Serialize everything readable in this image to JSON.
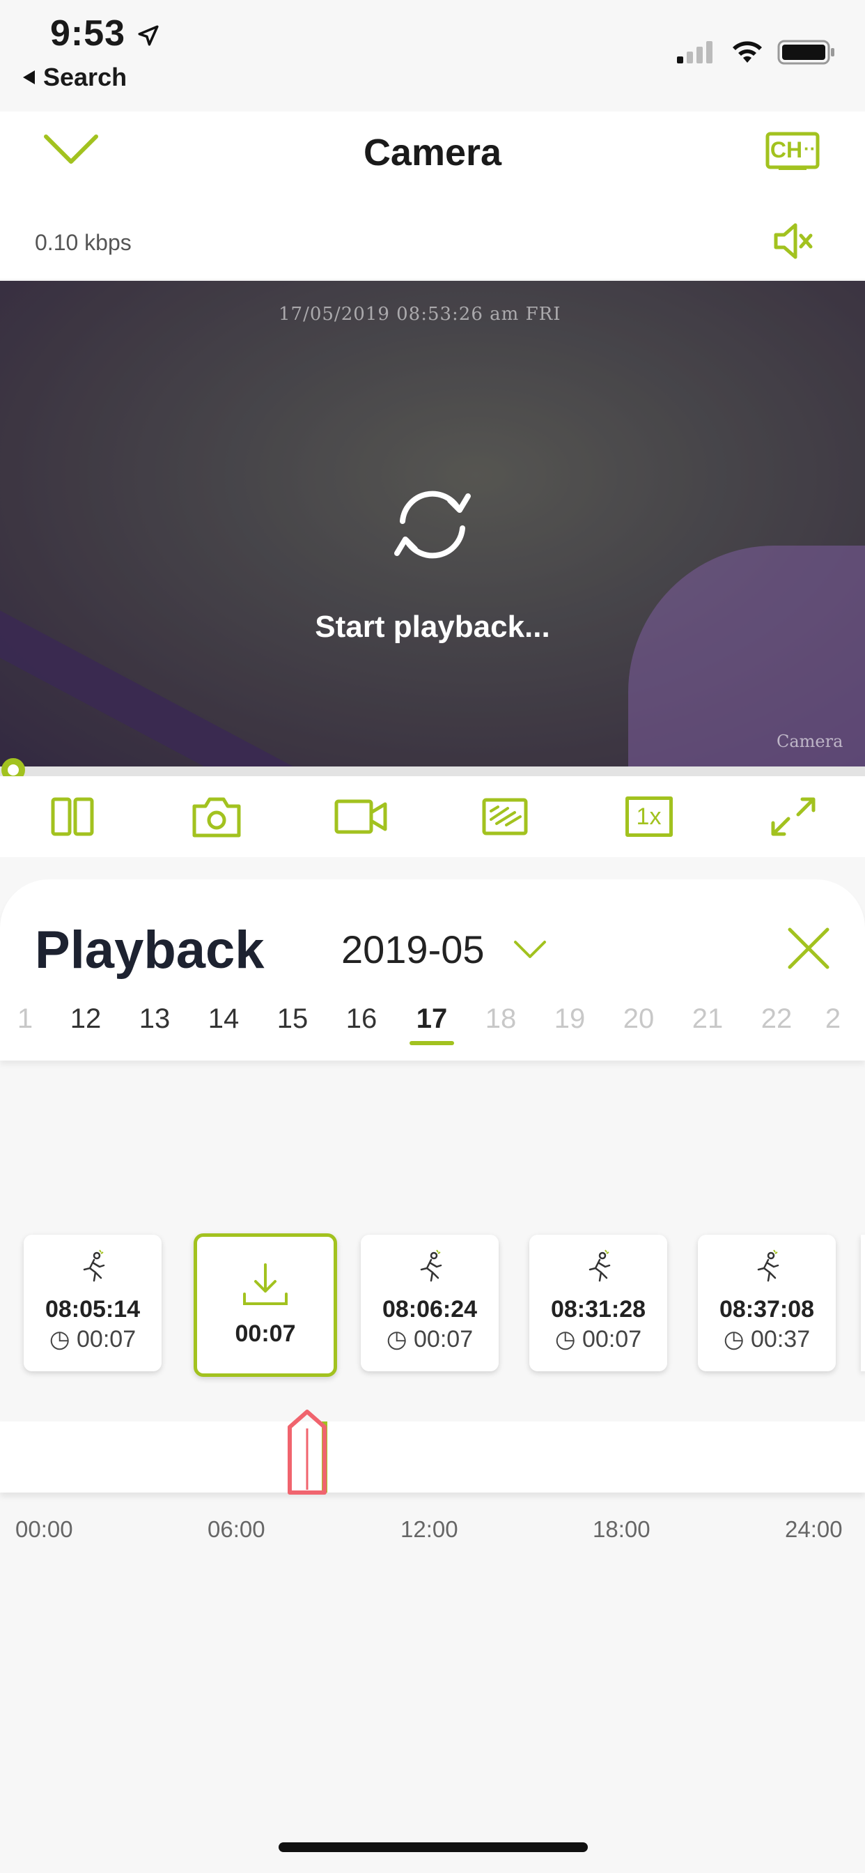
{
  "status": {
    "time": "9:53",
    "back_label": "Search"
  },
  "header": {
    "title": "Camera",
    "bitrate": "0.10 kbps",
    "channel_badge": "CH"
  },
  "video": {
    "osd_timestamp": "17/05/2019 08:53:26 am FRI",
    "osd_camera": "Camera",
    "loading_text": "Start playback...",
    "progress": 0
  },
  "toolbar": {
    "items": [
      {
        "icon": "split-view-icon"
      },
      {
        "icon": "snapshot-camera-icon"
      },
      {
        "icon": "record-video-icon"
      },
      {
        "icon": "quality-hd-icon"
      },
      {
        "icon": "speed-icon",
        "label": "1x"
      },
      {
        "icon": "fullscreen-icon"
      }
    ]
  },
  "playback": {
    "title": "Playback",
    "month": "2019-05",
    "days": [
      "1",
      "12",
      "13",
      "14",
      "15",
      "16",
      "17",
      "18",
      "19",
      "20",
      "21",
      "22",
      "2"
    ],
    "selected_day": "17"
  },
  "clips": [
    {
      "time": "08:05:14",
      "duration": "00:07"
    },
    {
      "time": "",
      "duration": "00:07",
      "selected": true
    },
    {
      "time": "08:06:24",
      "duration": "00:07"
    },
    {
      "time": "08:31:28",
      "duration": "00:07"
    },
    {
      "time": "08:37:08",
      "duration": "00:37"
    }
  ],
  "timeline": {
    "ticks": [
      "00:00",
      "06:00",
      "12:00",
      "18:00",
      "24:00"
    ]
  },
  "colors": {
    "accent": "#a2c21f",
    "marker": "#f0646e"
  }
}
